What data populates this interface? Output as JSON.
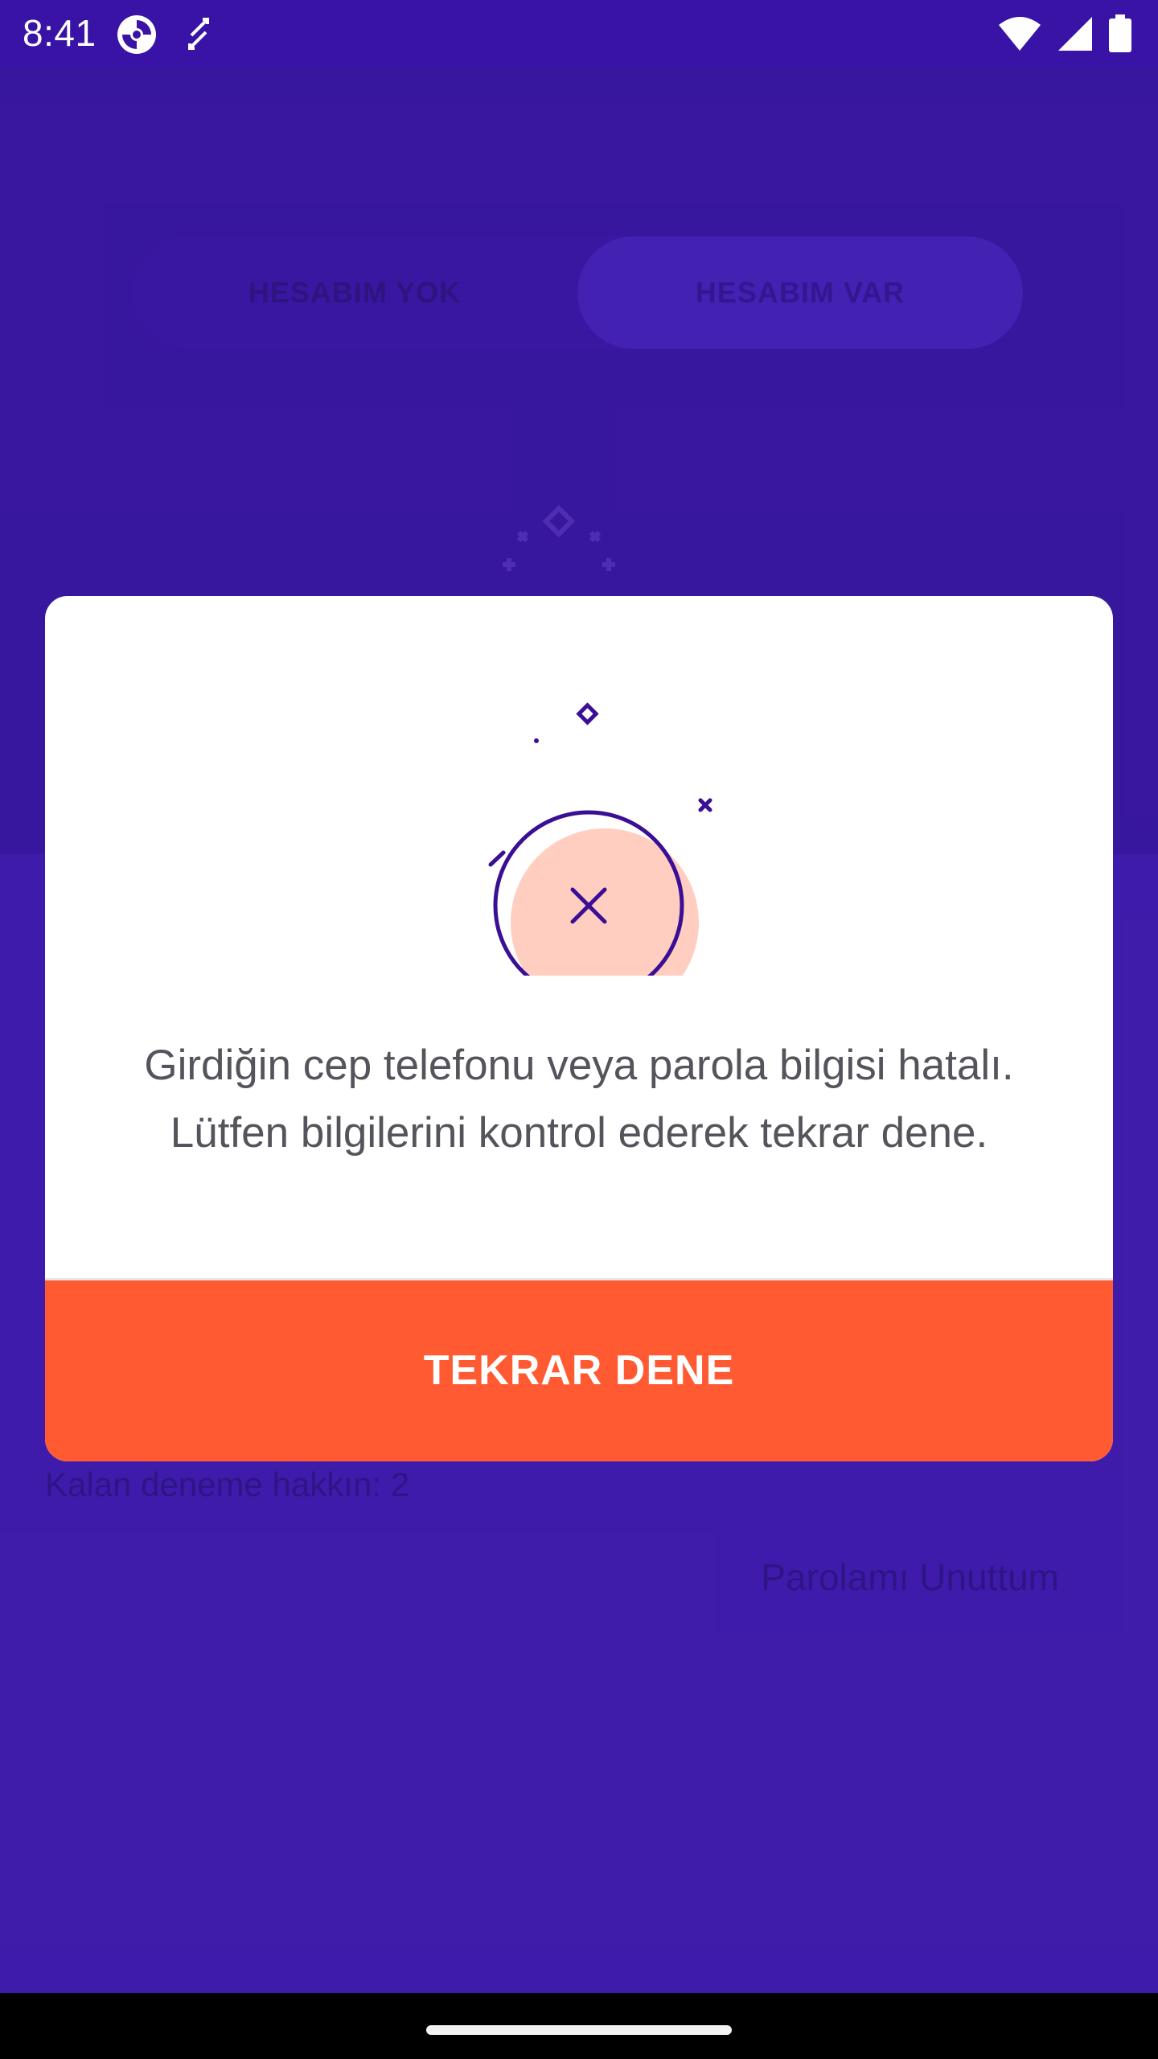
{
  "status_bar": {
    "time": "8:41",
    "icons": [
      "app-notification-icon",
      "sync-arrows-icon",
      "wifi-icon",
      "cellular-signal-icon",
      "battery-icon"
    ]
  },
  "background": {
    "tabs": [
      "HESABIM YOK",
      "HESABIM VAR"
    ],
    "remaining_attempts_text": "Kalan deneme hakkın: 2",
    "forgot_password_link": "Parolamı Unuttum"
  },
  "dialog": {
    "illustration": "error-x-circle-icon",
    "message_line1": "Girdiğin cep telefonu veya parola bilgisi hatalı.",
    "message_line2": "Lütfen bilgilerini kontrol ederek tekrar dene.",
    "button_label": "TEKRAR DENE"
  },
  "colors": {
    "primary": "#3913a6",
    "accent": "#ff5a32",
    "illustration_fill": "#ffcec0"
  }
}
